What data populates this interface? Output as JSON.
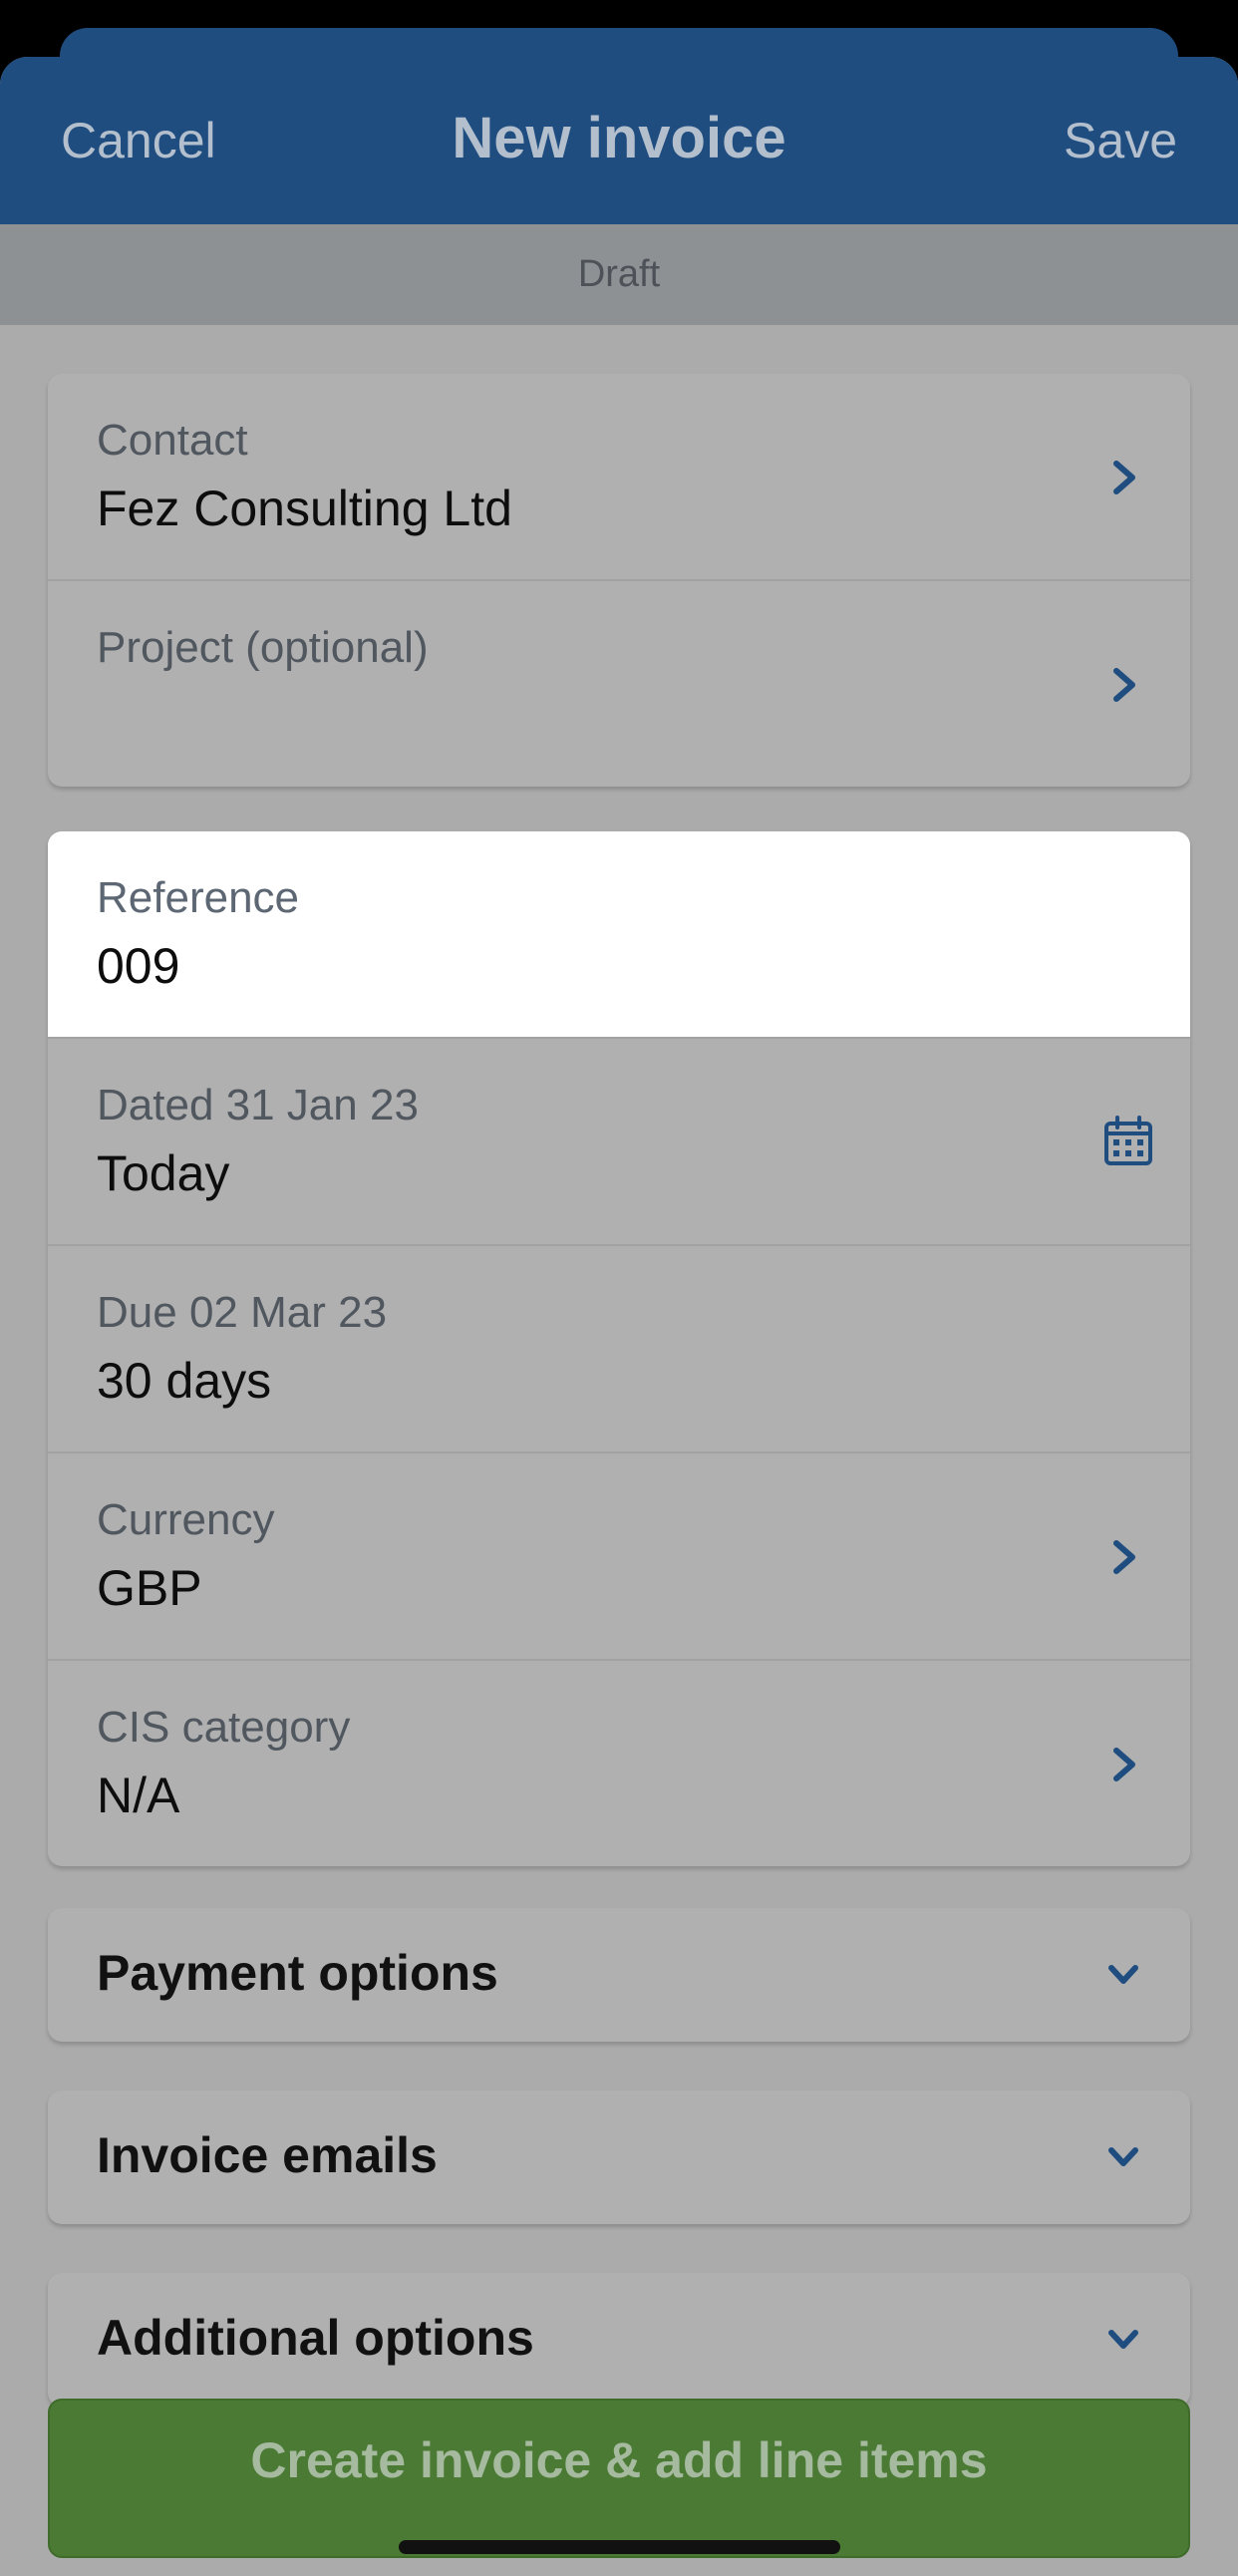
{
  "header": {
    "cancel_label": "Cancel",
    "title": "New invoice",
    "save_label": "Save"
  },
  "status": {
    "text": "Draft"
  },
  "contact_card": {
    "contact": {
      "label": "Contact",
      "value": "Fez Consulting Ltd",
      "icon": "chevron-right-icon"
    },
    "project": {
      "label": "Project (optional)",
      "value": "",
      "icon": "chevron-right-icon"
    }
  },
  "details_card": {
    "reference": {
      "label": "Reference",
      "value": "009"
    },
    "dated": {
      "label": "Dated 31 Jan 23",
      "value": "Today",
      "icon": "calendar-icon"
    },
    "due": {
      "label": "Due 02 Mar 23",
      "value": "30 days"
    },
    "currency": {
      "label": "Currency",
      "value": "GBP",
      "icon": "chevron-right-icon"
    },
    "cis_category": {
      "label": "CIS category",
      "value": "N/A",
      "icon": "chevron-right-icon"
    }
  },
  "sections": {
    "payment_options": {
      "label": "Payment options",
      "icon": "chevron-down-icon"
    },
    "invoice_emails": {
      "label": "Invoice emails",
      "icon": "chevron-down-icon"
    },
    "additional_options": {
      "label": "Additional options",
      "icon": "chevron-down-icon"
    }
  },
  "primary_action": {
    "label": "Create invoice & add line items"
  },
  "colors": {
    "nav": "#1f4d80",
    "accent_icon": "#1f4d80",
    "primary_button": "#4a7a33",
    "active_field": "#ffffff"
  }
}
